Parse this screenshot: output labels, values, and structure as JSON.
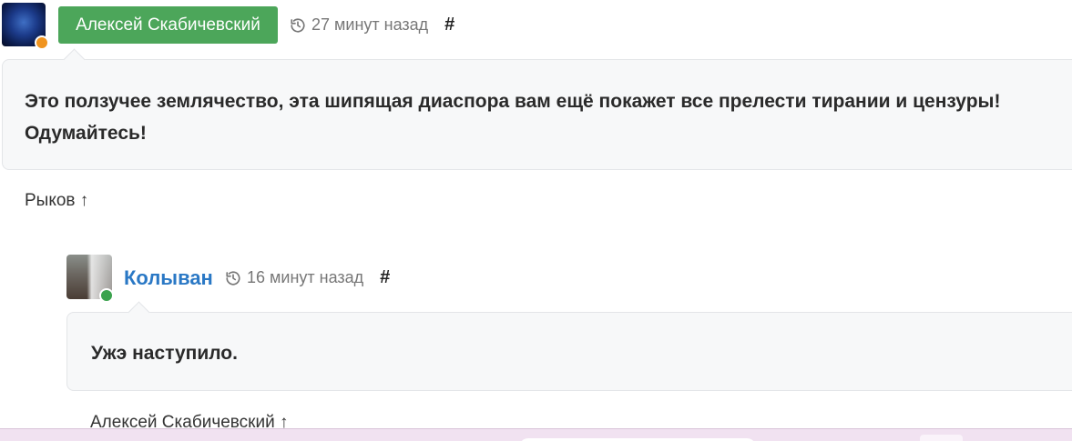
{
  "comments": [
    {
      "author": "Алексей Скабичевский",
      "status_color": "#f0941f",
      "time": "27 минут назад",
      "permalink": "#",
      "text": "Это ползучее землячество, эта шипящая диаспора вам ещё покажет все прелести тирании и цензуры! Одумайтесь!",
      "reply_to": "Рыков ↑"
    },
    {
      "author": "Колыван",
      "status_color": "#3aa24d",
      "time": "16 минут назад",
      "permalink": "#",
      "text": "Ужэ наступило.",
      "reply_to": "Алексей Скабичевский ↑"
    }
  ],
  "colors": {
    "author_badge_bg": "#4ca65a",
    "author_link": "#2a78c5",
    "bubble_bg": "#f7f8f9"
  },
  "icons": {
    "history": "history-icon",
    "status": "status-dot"
  }
}
